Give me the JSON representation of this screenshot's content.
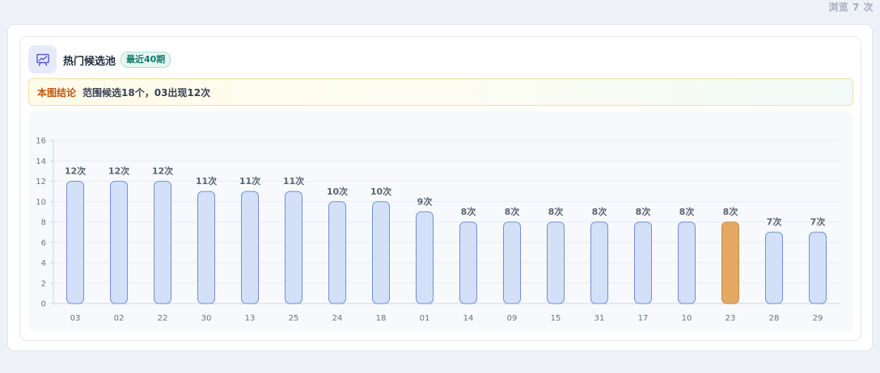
{
  "header": {
    "views_text": "浏览 7 次"
  },
  "card": {
    "icon": "presentation-chart-icon",
    "title": "热门候选池",
    "badge": "最近40期",
    "conclusion_label": "本图结论",
    "conclusion_text": "范围候选18个，03出现12次"
  },
  "colors": {
    "bar_fill": "#d3e0f8",
    "bar_stroke": "#6e8fdb",
    "highlight_fill": "#e4a862",
    "highlight_stroke": "#c98c45",
    "accent": "#5b5bd6"
  },
  "chart_data": {
    "type": "bar",
    "categories": [
      "03",
      "02",
      "22",
      "30",
      "13",
      "25",
      "24",
      "18",
      "01",
      "14",
      "09",
      "15",
      "31",
      "17",
      "10",
      "23",
      "28",
      "29"
    ],
    "values": [
      12,
      12,
      12,
      11,
      11,
      11,
      10,
      10,
      9,
      8,
      8,
      8,
      8,
      8,
      8,
      8,
      7,
      7
    ],
    "data_labels": [
      "12次",
      "12次",
      "12次",
      "11次",
      "11次",
      "11次",
      "10次",
      "10次",
      "9次",
      "8次",
      "8次",
      "8次",
      "8次",
      "8次",
      "8次",
      "8次",
      "7次",
      "7次"
    ],
    "highlight": "23",
    "ylim": [
      0,
      16
    ],
    "yticks": [
      0,
      2,
      4,
      6,
      8,
      10,
      12,
      14,
      16
    ],
    "grid": true,
    "title": "",
    "xlabel": "",
    "ylabel": ""
  }
}
